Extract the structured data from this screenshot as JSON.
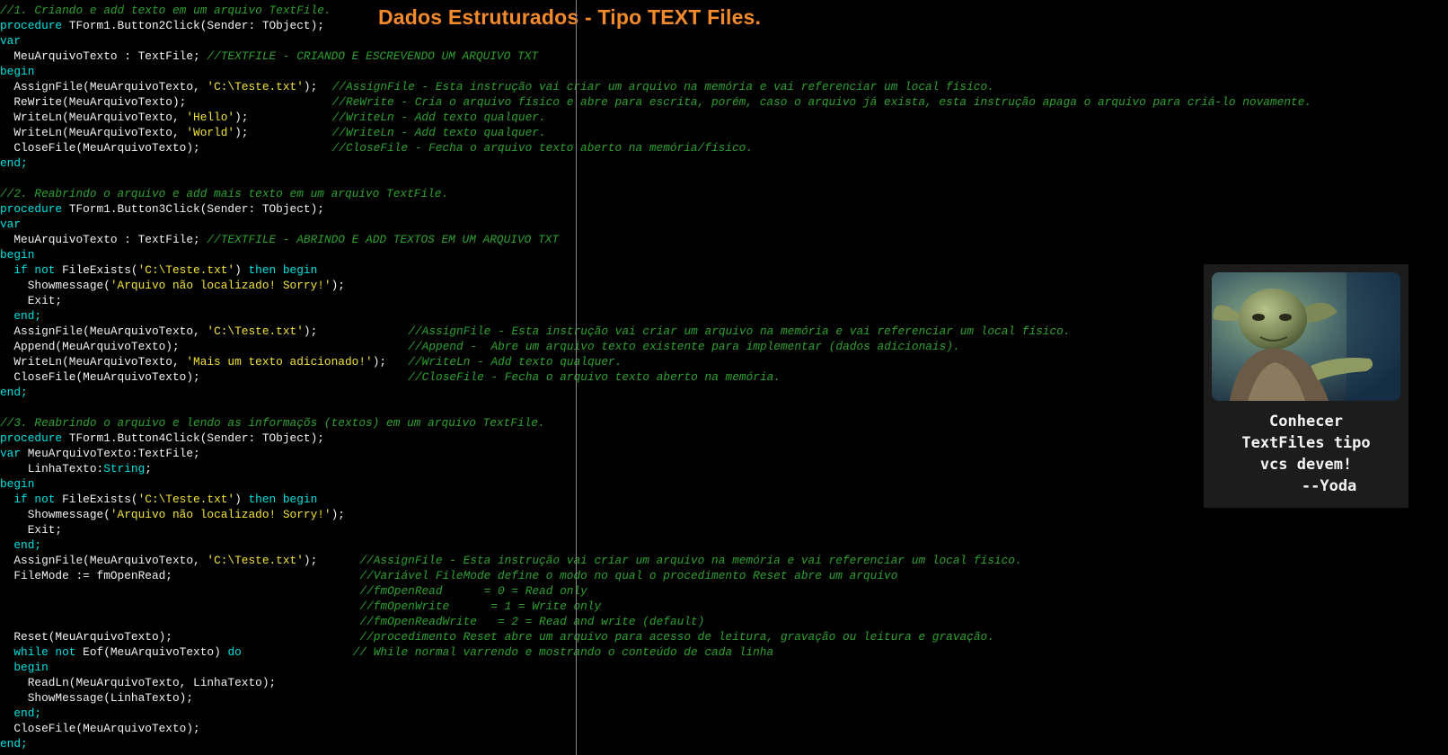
{
  "title": "Dados Estruturados - Tipo TEXT Files.",
  "colors": {
    "background": "#000000",
    "keyword": "#00e0e0",
    "text": "#f2f2f2",
    "string": "#f2e23a",
    "comment": "#2ea12e",
    "title": "#f58a2a",
    "card": "#1c1c1c"
  },
  "code_lines": [
    {
      "segs": [
        {
          "t": "//1. Criando e add texto em um arquivo TextFile.",
          "c": "cmt"
        }
      ]
    },
    {
      "segs": [
        {
          "t": "procedure",
          "c": "kw"
        },
        {
          "t": " TForm1.Button2Click(Sender: TObject);",
          "c": "tx"
        }
      ]
    },
    {
      "segs": [
        {
          "t": "var",
          "c": "kw"
        }
      ]
    },
    {
      "segs": [
        {
          "t": "  MeuArquivoTexto : TextFile; ",
          "c": "tx"
        },
        {
          "t": "//TEXTFILE - CRIANDO E ESCREVENDO UM ARQUIVO TXT",
          "c": "cmt"
        }
      ]
    },
    {
      "segs": [
        {
          "t": "begin",
          "c": "kw"
        }
      ]
    },
    {
      "segs": [
        {
          "t": "  AssignFile(MeuArquivoTexto, ",
          "c": "tx"
        },
        {
          "t": "'C:\\Teste.txt'",
          "c": "str"
        },
        {
          "t": ");",
          "c": "tx"
        }
      ],
      "comment": "//AssignFile - Esta instrução vai criar um arquivo na memória e vai referenciar um local físico.",
      "col": 48
    },
    {
      "segs": [
        {
          "t": "  ReWrite(MeuArquivoTexto);",
          "c": "tx"
        }
      ],
      "comment": "//ReWrite - Cria o arquivo físico e abre para escrita, porém, caso o arquivo já exista, esta instrução apaga o arquivo para criá-lo novamente.",
      "col": 48
    },
    {
      "segs": [
        {
          "t": "  WriteLn(MeuArquivoTexto, ",
          "c": "tx"
        },
        {
          "t": "'Hello'",
          "c": "str"
        },
        {
          "t": ");",
          "c": "tx"
        }
      ],
      "comment": "//WriteLn - Add texto qualquer.",
      "col": 48
    },
    {
      "segs": [
        {
          "t": "  WriteLn(MeuArquivoTexto, ",
          "c": "tx"
        },
        {
          "t": "'World'",
          "c": "str"
        },
        {
          "t": ");",
          "c": "tx"
        }
      ],
      "comment": "//WriteLn - Add texto qualquer.",
      "col": 48
    },
    {
      "segs": [
        {
          "t": "  CloseFile(MeuArquivoTexto);",
          "c": "tx"
        }
      ],
      "comment": "//CloseFile - Fecha o arquivo texto aberto na memória/físico.",
      "col": 48
    },
    {
      "segs": [
        {
          "t": "end;",
          "c": "kw"
        }
      ]
    },
    {
      "segs": []
    },
    {
      "segs": [
        {
          "t": "//2. Reabrindo o arquivo e add mais texto em um arquivo TextFile.",
          "c": "cmt"
        }
      ]
    },
    {
      "segs": [
        {
          "t": "procedure",
          "c": "kw"
        },
        {
          "t": " TForm1.Button3Click(Sender: TObject);",
          "c": "tx"
        }
      ]
    },
    {
      "segs": [
        {
          "t": "var",
          "c": "kw"
        }
      ]
    },
    {
      "segs": [
        {
          "t": "  MeuArquivoTexto : TextFile; ",
          "c": "tx"
        },
        {
          "t": "//TEXTFILE - ABRINDO E ADD TEXTOS EM UM ARQUIVO TXT",
          "c": "cmt"
        }
      ]
    },
    {
      "segs": [
        {
          "t": "begin",
          "c": "kw"
        }
      ]
    },
    {
      "segs": [
        {
          "t": "  if not",
          "c": "kw"
        },
        {
          "t": " FileExists(",
          "c": "tx"
        },
        {
          "t": "'C:\\Teste.txt'",
          "c": "str"
        },
        {
          "t": ") ",
          "c": "tx"
        },
        {
          "t": "then begin",
          "c": "kw"
        }
      ]
    },
    {
      "segs": [
        {
          "t": "    Showmessage(",
          "c": "tx"
        },
        {
          "t": "'Arquivo não localizado! Sorry!'",
          "c": "str"
        },
        {
          "t": ");",
          "c": "tx"
        }
      ]
    },
    {
      "segs": [
        {
          "t": "    Exit;",
          "c": "tx"
        }
      ]
    },
    {
      "segs": [
        {
          "t": "  end;",
          "c": "kw"
        }
      ]
    },
    {
      "segs": [
        {
          "t": "  AssignFile(MeuArquivoTexto, ",
          "c": "tx"
        },
        {
          "t": "'C:\\Teste.txt'",
          "c": "str"
        },
        {
          "t": ");",
          "c": "tx"
        }
      ],
      "comment": "//AssignFile - Esta instrução vai criar um arquivo na memória e vai referenciar um local físico.",
      "col": 59
    },
    {
      "segs": [
        {
          "t": "  Append(MeuArquivoTexto);",
          "c": "tx"
        }
      ],
      "comment": "//Append -  Abre um arquivo texto existente para implementar (dados adicionais).",
      "col": 59
    },
    {
      "segs": [
        {
          "t": "  WriteLn(MeuArquivoTexto, ",
          "c": "tx"
        },
        {
          "t": "'Mais um texto adicionado!'",
          "c": "str"
        },
        {
          "t": ");",
          "c": "tx"
        }
      ],
      "comment": "//WriteLn - Add texto qualquer.",
      "col": 59
    },
    {
      "segs": [
        {
          "t": "  CloseFile(MeuArquivoTexto);",
          "c": "tx"
        }
      ],
      "comment": "//CloseFile - Fecha o arquivo texto aberto na memória.",
      "col": 59
    },
    {
      "segs": [
        {
          "t": "end;",
          "c": "kw"
        }
      ]
    },
    {
      "segs": []
    },
    {
      "segs": [
        {
          "t": "//3. Reabrindo o arquivo e lendo as informaçõs (textos) em um arquivo TextFile.",
          "c": "cmt"
        }
      ]
    },
    {
      "segs": [
        {
          "t": "procedure",
          "c": "kw"
        },
        {
          "t": " TForm1.Button4Click(Sender: TObject);",
          "c": "tx"
        }
      ]
    },
    {
      "segs": [
        {
          "t": "var",
          "c": "kw"
        },
        {
          "t": " MeuArquivoTexto:TextFile;",
          "c": "tx"
        }
      ]
    },
    {
      "segs": [
        {
          "t": "    LinhaTexto:",
          "c": "tx"
        },
        {
          "t": "String",
          "c": "kw"
        },
        {
          "t": ";",
          "c": "tx"
        }
      ]
    },
    {
      "segs": [
        {
          "t": "begin",
          "c": "kw"
        }
      ]
    },
    {
      "segs": [
        {
          "t": "  if not",
          "c": "kw"
        },
        {
          "t": " FileExists(",
          "c": "tx"
        },
        {
          "t": "'C:\\Teste.txt'",
          "c": "str"
        },
        {
          "t": ") ",
          "c": "tx"
        },
        {
          "t": "then begin",
          "c": "kw"
        }
      ]
    },
    {
      "segs": [
        {
          "t": "    Showmessage(",
          "c": "tx"
        },
        {
          "t": "'Arquivo não localizado! Sorry!'",
          "c": "str"
        },
        {
          "t": ");",
          "c": "tx"
        }
      ]
    },
    {
      "segs": [
        {
          "t": "    Exit;",
          "c": "tx"
        }
      ]
    },
    {
      "segs": [
        {
          "t": "  end;",
          "c": "kw"
        }
      ]
    },
    {
      "segs": [
        {
          "t": "  AssignFile(MeuArquivoTexto, ",
          "c": "tx"
        },
        {
          "t": "'C:\\Teste.txt'",
          "c": "str"
        },
        {
          "t": ");",
          "c": "tx"
        }
      ],
      "comment": "//AssignFile - Esta instrução vai criar um arquivo na memória e vai referenciar um local físico.",
      "col": 52
    },
    {
      "segs": [
        {
          "t": "  FileMode := fmOpenRead;",
          "c": "tx"
        }
      ],
      "comment": "//Variável FileMode define o modo no qual o procedimento Reset abre um arquivo",
      "col": 52
    },
    {
      "segs": [],
      "comment": "//fmOpenRead      = 0 = Read only",
      "col": 52
    },
    {
      "segs": [],
      "comment": "//fmOpenWrite      = 1 = Write only",
      "col": 52
    },
    {
      "segs": [],
      "comment": "//fmOpenReadWrite   = 2 = Read and write (default)",
      "col": 52
    },
    {
      "segs": [
        {
          "t": "  Reset(MeuArquivoTexto);",
          "c": "tx"
        }
      ],
      "comment": "//procedimento Reset abre um arquivo para acesso de leitura, gravação ou leitura e gravação.",
      "col": 52
    },
    {
      "segs": [
        {
          "t": "  while not",
          "c": "kw"
        },
        {
          "t": " Eof(MeuArquivoTexto) ",
          "c": "tx"
        },
        {
          "t": "do",
          "c": "kw"
        }
      ],
      "comment": "// While normal varrendo e mostrando o conteúdo de cada linha",
      "col": 51
    },
    {
      "segs": [
        {
          "t": "  begin",
          "c": "kw"
        }
      ]
    },
    {
      "segs": [
        {
          "t": "    ReadLn(MeuArquivoTexto, LinhaTexto);",
          "c": "tx"
        }
      ]
    },
    {
      "segs": [
        {
          "t": "    ShowMessage(LinhaTexto);",
          "c": "tx"
        }
      ]
    },
    {
      "segs": [
        {
          "t": "  end;",
          "c": "kw"
        }
      ]
    },
    {
      "segs": [
        {
          "t": "  CloseFile(MeuArquivoTexto);",
          "c": "tx"
        }
      ]
    },
    {
      "segs": [
        {
          "t": "end;",
          "c": "kw"
        }
      ]
    }
  ],
  "yoda_card": {
    "image_icon": "yoda-photo",
    "caption_lines": [
      "Conhecer",
      "TextFiles tipo",
      "vcs devem!",
      "     --Yoda"
    ]
  }
}
